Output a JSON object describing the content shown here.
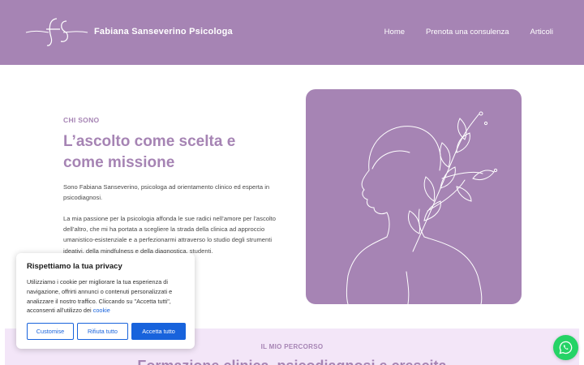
{
  "header": {
    "brand": "Fabiana Sanseverino Psicologa",
    "logo_icon": "fs-monogram-logo",
    "nav": [
      "Home",
      "Prenota una consulenza",
      "Articoli"
    ]
  },
  "hero": {
    "kicker": "CHI SONO",
    "title": "L’ascolto come scelta e come missione",
    "paragraph_1": "Sono Fabiana Sanseverino, psicologa ad orientamento clinico ed esperta in psicodiagnosi.",
    "paragraph_2": "La mia passione per la psicologia affonda le sue radici nell’amore per l’ascolto dell’altro, che mi ha portata a scegliere la strada della clinica ad approccio umanistico-esistenziale e a perfezionarmi attraverso lo studio degli strumenti ideativi, della mindfulness e della diagnostica, studenti.",
    "illustration_icon": "woman-with-flowers-line-art"
  },
  "section2": {
    "kicker": "IL MIO PERCORSO",
    "title": "Formazione clinica, psicodiagnosi e crescita"
  },
  "cookie_banner": {
    "title": "Rispettiamo la tua privacy",
    "text": "Utilizziamo i cookie per migliorare la tua esperienza di navigazione, offrirti annunci o contenuti personalizzati e analizzare il nostro traffico. Cliccando su \"Accetta tutti\", acconsenti all'utilizzo dei ",
    "link": "cookie",
    "customise_label": "Customise",
    "reject_label": "Rifiuta tutto",
    "accept_label": "Accetta tutto"
  },
  "whatsapp_icon": "whatsapp-icon",
  "colors": {
    "brand_purple": "#a684b4",
    "section_bg": "#f3e6f8",
    "cookie_blue": "#1863dc",
    "whatsapp_green": "#25d366"
  }
}
